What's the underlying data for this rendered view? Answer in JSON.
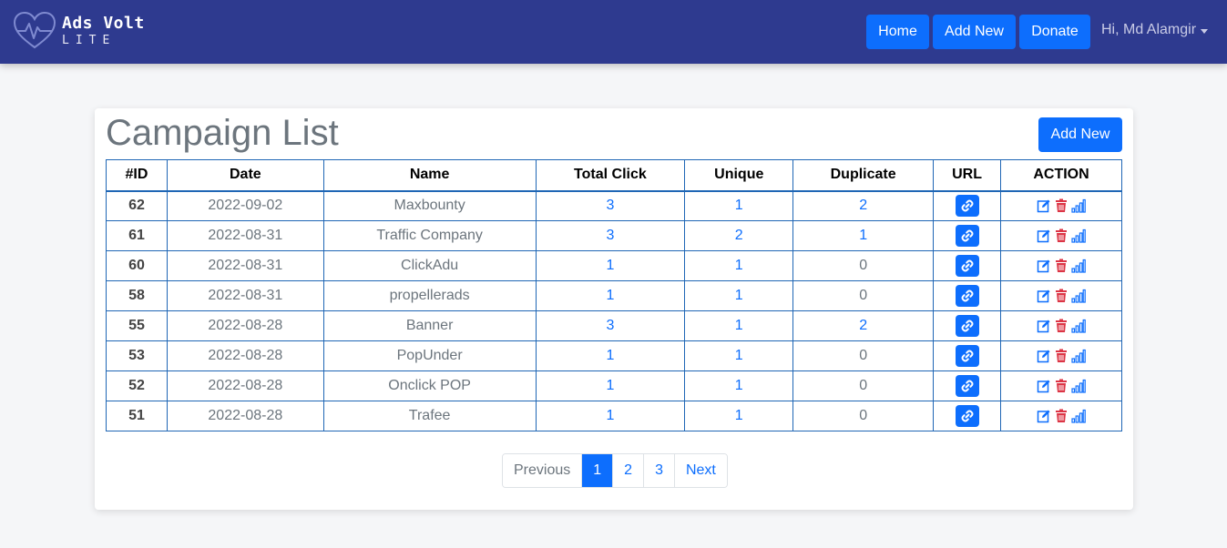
{
  "app": {
    "name": "Ads Volt",
    "edition": "LITE"
  },
  "nav": {
    "home_label": "Home",
    "add_new_label": "Add New",
    "donate_label": "Donate",
    "user_greeting": "Hi, Md Alamgir"
  },
  "page": {
    "title": "Campaign List",
    "add_new_label": "Add New"
  },
  "table": {
    "headers": [
      "#ID",
      "Date",
      "Name",
      "Total Click",
      "Unique",
      "Duplicate",
      "URL",
      "ACTION"
    ],
    "rows": [
      {
        "id": "62",
        "date": "2022-09-02",
        "name": "Maxbounty",
        "total": "3",
        "unique": "1",
        "duplicate": "2"
      },
      {
        "id": "61",
        "date": "2022-08-31",
        "name": "Traffic Company",
        "total": "3",
        "unique": "2",
        "duplicate": "1"
      },
      {
        "id": "60",
        "date": "2022-08-31",
        "name": "ClickAdu",
        "total": "1",
        "unique": "1",
        "duplicate": "0"
      },
      {
        "id": "58",
        "date": "2022-08-31",
        "name": "propellerads",
        "total": "1",
        "unique": "1",
        "duplicate": "0"
      },
      {
        "id": "55",
        "date": "2022-08-28",
        "name": "Banner",
        "total": "3",
        "unique": "1",
        "duplicate": "2"
      },
      {
        "id": "53",
        "date": "2022-08-28",
        "name": "PopUnder",
        "total": "1",
        "unique": "1",
        "duplicate": "0"
      },
      {
        "id": "52",
        "date": "2022-08-28",
        "name": "Onclick POP",
        "total": "1",
        "unique": "1",
        "duplicate": "0"
      },
      {
        "id": "51",
        "date": "2022-08-28",
        "name": "Trafee",
        "total": "1",
        "unique": "1",
        "duplicate": "0"
      }
    ]
  },
  "pagination": {
    "previous_label": "Previous",
    "pages": [
      "1",
      "2",
      "3"
    ],
    "current_page": "1",
    "next_label": "Next"
  },
  "icons": {
    "url_button": "link-icon",
    "actions": [
      "edit-icon",
      "delete-icon",
      "stats-icon"
    ]
  },
  "colors": {
    "navbar": "#2e3a8f",
    "primary": "#0d6efd",
    "danger": "#dc3545",
    "table_border": "#1f66b5"
  }
}
